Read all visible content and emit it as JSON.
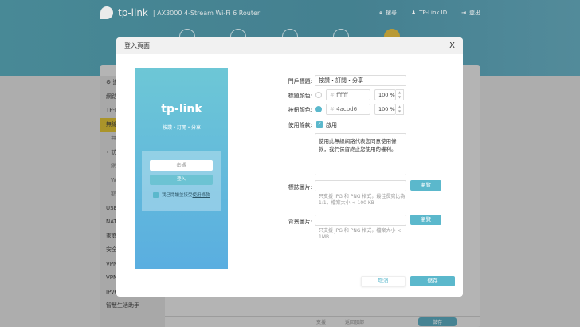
{
  "header": {
    "brand": "tp-link",
    "model": "AX3000 4-Stream Wi-Fi 6 Router",
    "search": "搜尋",
    "tplink_id": "TP-Link ID",
    "logout": "登出"
  },
  "sidebar": {
    "items": [
      "⚙ 進",
      "網路",
      "TP-L",
      "無線",
      "無",
      "• 訪",
      "網",
      "Wi",
      "額",
      "USB",
      "NAT",
      "家庭",
      "安全",
      "VPN",
      "VPN",
      "IPv6",
      "智慧生活助手"
    ]
  },
  "bottombar": {
    "support": "支援",
    "back_to_top": "返回頂部",
    "save": "儲存"
  },
  "modal": {
    "title": "登入頁面",
    "close": "X",
    "preview": {
      "logo": "tp-link",
      "subtitle": "按讚・訂閱・分享",
      "password_placeholder": "密碼",
      "login": "登入",
      "agree_text": "我已閱讀並接受",
      "terms_link": "使用條款"
    },
    "form": {
      "portal_title_label": "門戶標題:",
      "portal_title_value": "按讚・訂閱・分享",
      "title_color_label": "標題顏色:",
      "title_color_value": "ffffff",
      "title_color_hash": "#",
      "title_opacity": "100 %",
      "button_color_label": "按鈕顏色:",
      "button_color_value": "4acbd6",
      "button_color_hash": "#",
      "button_opacity": "100 %",
      "terms_label": "使用條款:",
      "terms_enable": "啟用",
      "terms_text": "使用此無線網路代表您同意使用條款，我們保留終止您使用的權利。",
      "logo_label": "標誌圖片:",
      "logo_browse": "瀏覽",
      "logo_hint": "只支援 JPG 和 PNG 格式，最佳長寬比為 1:1，檔案大小 < 100 KB",
      "bg_label": "背景圖片:",
      "bg_browse": "瀏覽",
      "bg_hint": "只支援 JPG 和 PNG 格式，檔案大小 < 1MB"
    },
    "cancel": "取消",
    "save": "儲存"
  },
  "colors": {
    "accent": "#5bb8cc",
    "header": "#4f95a3",
    "active_nav": "#c9a83a",
    "button_color_swatch": "#4acbd6"
  }
}
